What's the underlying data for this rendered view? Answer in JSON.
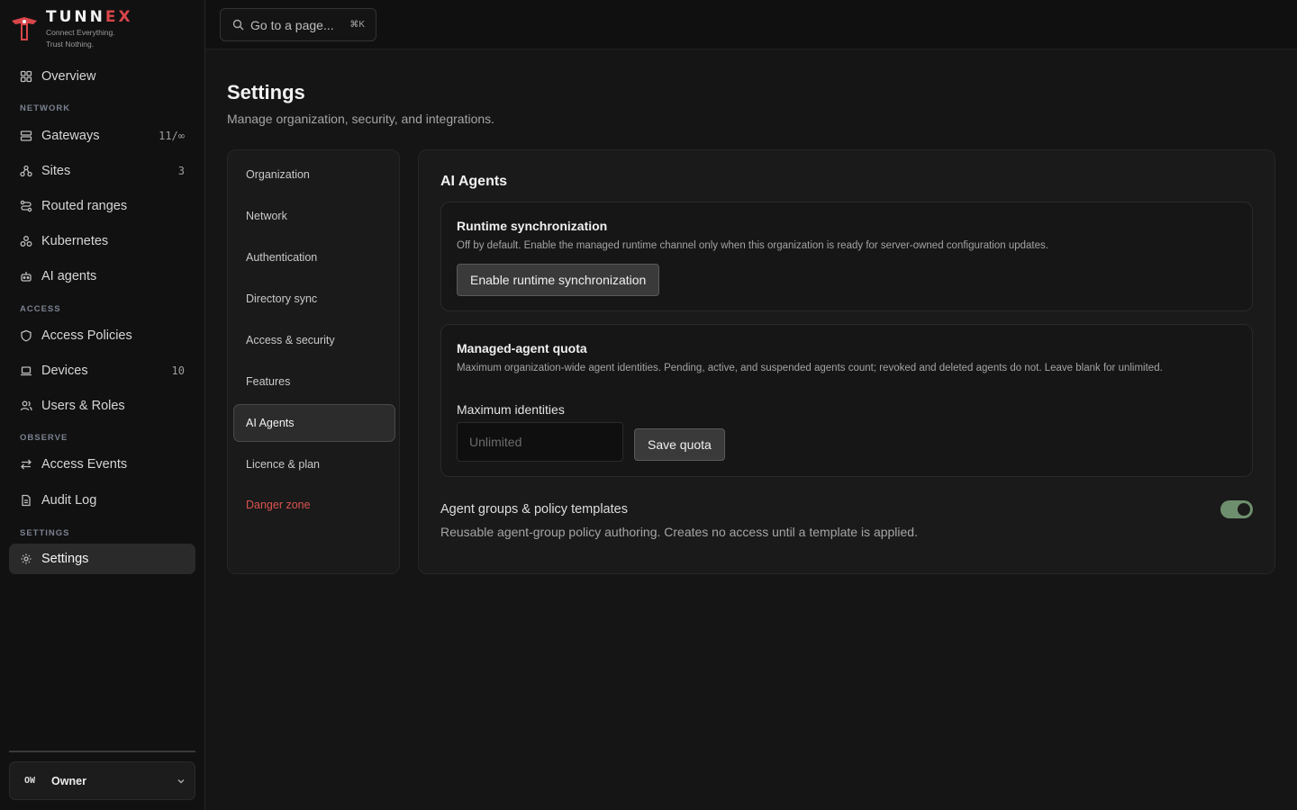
{
  "brand": {
    "name_main": "TUNN",
    "name_accent": "EX",
    "tagline_1": "Connect Everything.",
    "tagline_2": "Trust Nothing.",
    "accent_color": "#d9464a"
  },
  "topbar": {
    "search_placeholder": "Go to a page...",
    "search_shortcut": "⌘K"
  },
  "sidebar": {
    "overview": {
      "label": "Overview",
      "icon": "grid-icon"
    },
    "sections": {
      "network": "NETWORK",
      "access": "ACCESS",
      "observe": "OBSERVE",
      "settings": "SETTINGS"
    },
    "items": [
      {
        "label": "Gateways",
        "count": "11/∞",
        "icon": "server-icon"
      },
      {
        "label": "Sites",
        "count": "3",
        "icon": "sites-icon"
      },
      {
        "label": "Routed ranges",
        "count": "",
        "icon": "route-icon"
      },
      {
        "label": "Kubernetes",
        "count": "",
        "icon": "kubernetes-icon"
      },
      {
        "label": "AI agents",
        "count": "",
        "icon": "bot-icon"
      },
      {
        "label": "Access Policies",
        "count": "",
        "icon": "shield-icon"
      },
      {
        "label": "Devices",
        "count": "10",
        "icon": "laptop-icon"
      },
      {
        "label": "Users & Roles",
        "count": "",
        "icon": "users-icon"
      },
      {
        "label": "Access Events",
        "count": "",
        "icon": "arrows-icon"
      },
      {
        "label": "Audit Log",
        "count": "",
        "icon": "file-icon"
      },
      {
        "label": "Settings",
        "count": "",
        "icon": "gear-icon",
        "active": true
      }
    ],
    "user": {
      "initials": "OW",
      "name": "Owner"
    }
  },
  "page": {
    "title": "Settings",
    "subtitle": "Manage organization, security, and integrations."
  },
  "settings_nav": [
    {
      "label": "Organization"
    },
    {
      "label": "Network"
    },
    {
      "label": "Authentication"
    },
    {
      "label": "Directory sync"
    },
    {
      "label": "Access & security"
    },
    {
      "label": "Features"
    },
    {
      "label": "AI Agents",
      "active": true
    },
    {
      "label": "Licence & plan"
    },
    {
      "label": "Danger zone",
      "danger": true
    }
  ],
  "panel": {
    "title": "AI Agents",
    "runtime": {
      "title": "Runtime synchronization",
      "description": "Off by default. Enable the managed runtime channel only when this organization is ready for server-owned configuration updates.",
      "button": "Enable runtime synchronization"
    },
    "quota": {
      "title": "Managed-agent quota",
      "description": "Maximum organization-wide agent identities. Pending, active, and suspended agents count; revoked and deleted agents do not. Leave blank for unlimited.",
      "field_label": "Maximum identities",
      "placeholder": "Unlimited",
      "value": "",
      "button": "Save quota"
    },
    "groups": {
      "title": "Agent groups & policy templates",
      "description": "Reusable agent-group policy authoring. Creates no access until a template is applied.",
      "enabled": true,
      "toggle_color": "#6e8f6e"
    }
  }
}
